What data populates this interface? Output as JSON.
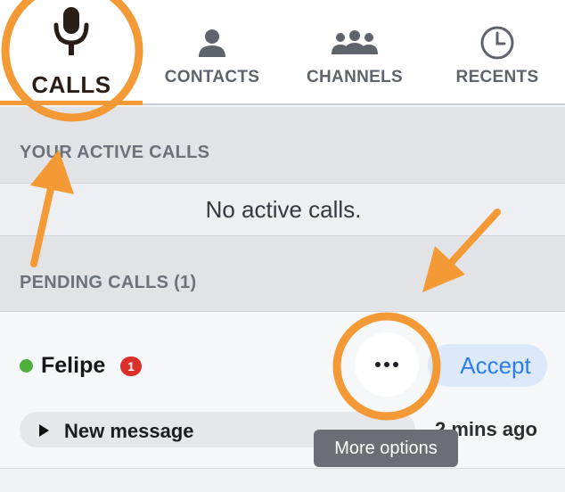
{
  "tabs": [
    {
      "id": "calls",
      "label": "CALLS",
      "icon": "microphone-icon",
      "active": true
    },
    {
      "id": "contacts",
      "label": "CONTACTS",
      "icon": "person-icon",
      "active": false
    },
    {
      "id": "channels",
      "label": "CHANNELS",
      "icon": "group-icon",
      "active": false
    },
    {
      "id": "recents",
      "label": "RECENTS",
      "icon": "clock-icon",
      "active": false
    }
  ],
  "active_calls": {
    "header": "YOUR ACTIVE CALLS",
    "empty_text": "No active calls."
  },
  "pending_calls": {
    "header": "PENDING CALLS (1)",
    "items": [
      {
        "caller": "Felipe",
        "unread_count": "1",
        "status": "online",
        "message_label": "New message",
        "timestamp": "2 mins ago",
        "accept_label": "Accept",
        "more_tooltip": "More options"
      }
    ]
  },
  "colors": {
    "annotation": "#f39a36",
    "accent_blue": "#2b7de9",
    "accept_bg": "#dce9fb",
    "online_green": "#4caf3e",
    "badge_red": "#d9302c",
    "active_icon": "#2a1c16",
    "inactive_icon": "#5f646c"
  },
  "annotations": {
    "highlight_circles": [
      "calls-tab",
      "more-options-button"
    ],
    "arrows": [
      "to-active-calls-header",
      "to-more-options-button"
    ]
  }
}
